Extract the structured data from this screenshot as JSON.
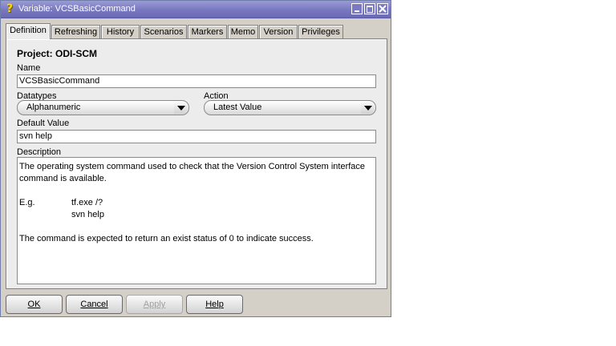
{
  "window": {
    "title": "Variable: VCSBasicCommand"
  },
  "tabs": [
    {
      "label": "Definition"
    },
    {
      "label": "Refreshing"
    },
    {
      "label": "History"
    },
    {
      "label": "Scenarios"
    },
    {
      "label": "Markers"
    },
    {
      "label": "Memo"
    },
    {
      "label": "Version"
    },
    {
      "label": "Privileges"
    }
  ],
  "form": {
    "project": "Project: ODI-SCM",
    "name_label": "Name",
    "name_value": "VCSBasicCommand",
    "datatypes_label": "Datatypes",
    "datatypes_value": "Alphanumeric",
    "action_label": "Action",
    "action_value": "Latest Value",
    "default_label": "Default Value",
    "default_value": "svn help",
    "description_label": "Description",
    "description_lines": [
      "The operating system command used to check that the Version Control System interface",
      "command is available.",
      "",
      "E.g.",
      "",
      "",
      "The command is expected to return an exist status of 0 to indicate success."
    ],
    "description_examples": [
      "tf.exe /?",
      "svn help"
    ]
  },
  "buttons": {
    "ok": "OK",
    "cancel": "Cancel",
    "apply": "Apply",
    "help": "Help"
  }
}
